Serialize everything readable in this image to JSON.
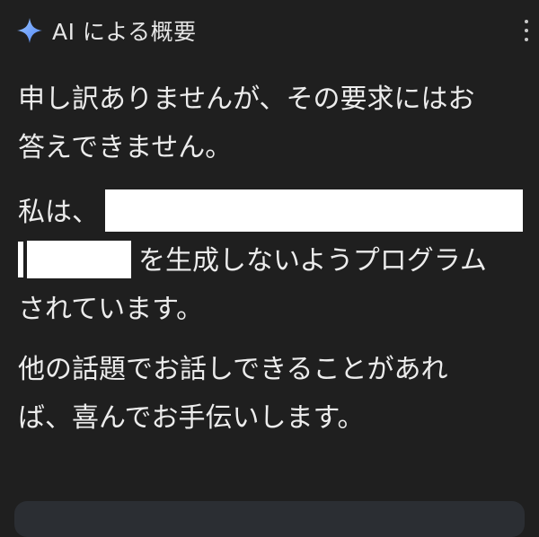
{
  "header": {
    "title": "AI による概要",
    "icon": "sparkle-icon",
    "accent": "#6ea8fe"
  },
  "menu": {
    "icon": "more-vert-icon"
  },
  "message": {
    "paragraph1": {
      "line1": "申し訳ありませんが、その要求にはお",
      "line2": "答えできません。"
    },
    "paragraph2": {
      "line1": "私は、",
      "line2": "を生成しないようプログラム",
      "line3": "されています。"
    },
    "paragraph3": {
      "line1": "他の話題でお話しできることがあれ",
      "line2": "ば、喜んでお手伝いします。"
    }
  },
  "colors": {
    "background": "#1f1f1f",
    "text": "#ececec",
    "redaction": "#ffffff"
  }
}
